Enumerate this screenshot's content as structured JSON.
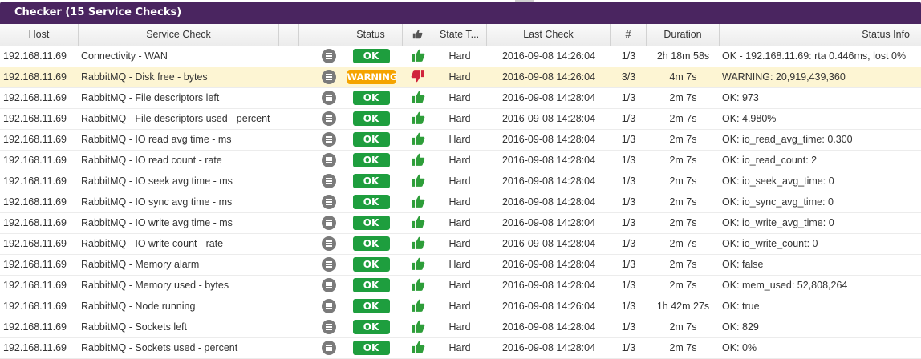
{
  "panel": {
    "title": "Checker (15 Service Checks)"
  },
  "columns": {
    "host": "Host",
    "service_check": "Service Check",
    "status": "Status",
    "ack_icon": "thumbs-up-icon",
    "state_type": "State T...",
    "last_check": "Last Check",
    "attempt": "#",
    "duration": "Duration",
    "status_info": "Status Info"
  },
  "colors": {
    "title_bar": "#4a2560",
    "ok": "#1e9e3e",
    "warning": "#f5a400",
    "thumb_up": "#2e9e3a",
    "thumb_down": "#d0233c",
    "warning_row": "#fdf5d3"
  },
  "rows": [
    {
      "host": "192.168.11.69",
      "service": "Connectivity - WAN",
      "status": "OK",
      "ack": "thumbs-up",
      "state_type": "Hard",
      "last_check": "2016-09-08 14:26:04",
      "attempt": "1/3",
      "duration": "2h 18m 58s",
      "info": "OK - 192.168.11.69: rta 0.446ms, lost 0%"
    },
    {
      "host": "192.168.11.69",
      "service": "RabbitMQ - Disk free - bytes",
      "status": "WARNING",
      "ack": "thumbs-down",
      "state_type": "Hard",
      "last_check": "2016-09-08 14:26:04",
      "attempt": "3/3",
      "duration": "4m 7s",
      "info": "WARNING: 20,919,439,360"
    },
    {
      "host": "192.168.11.69",
      "service": "RabbitMQ - File descriptors left",
      "status": "OK",
      "ack": "thumbs-up",
      "state_type": "Hard",
      "last_check": "2016-09-08 14:28:04",
      "attempt": "1/3",
      "duration": "2m 7s",
      "info": "OK: 973"
    },
    {
      "host": "192.168.11.69",
      "service": "RabbitMQ - File descriptors used - percent",
      "status": "OK",
      "ack": "thumbs-up",
      "state_type": "Hard",
      "last_check": "2016-09-08 14:28:04",
      "attempt": "1/3",
      "duration": "2m 7s",
      "info": "OK: 4.980%"
    },
    {
      "host": "192.168.11.69",
      "service": "RabbitMQ - IO read avg time - ms",
      "status": "OK",
      "ack": "thumbs-up",
      "state_type": "Hard",
      "last_check": "2016-09-08 14:28:04",
      "attempt": "1/3",
      "duration": "2m 7s",
      "info": "OK: io_read_avg_time: 0.300"
    },
    {
      "host": "192.168.11.69",
      "service": "RabbitMQ - IO read count - rate",
      "status": "OK",
      "ack": "thumbs-up",
      "state_type": "Hard",
      "last_check": "2016-09-08 14:28:04",
      "attempt": "1/3",
      "duration": "2m 7s",
      "info": "OK: io_read_count: 2"
    },
    {
      "host": "192.168.11.69",
      "service": "RabbitMQ - IO seek avg time - ms",
      "status": "OK",
      "ack": "thumbs-up",
      "state_type": "Hard",
      "last_check": "2016-09-08 14:28:04",
      "attempt": "1/3",
      "duration": "2m 7s",
      "info": "OK: io_seek_avg_time: 0"
    },
    {
      "host": "192.168.11.69",
      "service": "RabbitMQ - IO sync avg time - ms",
      "status": "OK",
      "ack": "thumbs-up",
      "state_type": "Hard",
      "last_check": "2016-09-08 14:28:04",
      "attempt": "1/3",
      "duration": "2m 7s",
      "info": "OK: io_sync_avg_time: 0"
    },
    {
      "host": "192.168.11.69",
      "service": "RabbitMQ - IO write avg time - ms",
      "status": "OK",
      "ack": "thumbs-up",
      "state_type": "Hard",
      "last_check": "2016-09-08 14:28:04",
      "attempt": "1/3",
      "duration": "2m 7s",
      "info": "OK: io_write_avg_time: 0"
    },
    {
      "host": "192.168.11.69",
      "service": "RabbitMQ - IO write count - rate",
      "status": "OK",
      "ack": "thumbs-up",
      "state_type": "Hard",
      "last_check": "2016-09-08 14:28:04",
      "attempt": "1/3",
      "duration": "2m 7s",
      "info": "OK: io_write_count: 0"
    },
    {
      "host": "192.168.11.69",
      "service": "RabbitMQ - Memory alarm",
      "status": "OK",
      "ack": "thumbs-up",
      "state_type": "Hard",
      "last_check": "2016-09-08 14:28:04",
      "attempt": "1/3",
      "duration": "2m 7s",
      "info": "OK: false"
    },
    {
      "host": "192.168.11.69",
      "service": "RabbitMQ - Memory used - bytes",
      "status": "OK",
      "ack": "thumbs-up",
      "state_type": "Hard",
      "last_check": "2016-09-08 14:28:04",
      "attempt": "1/3",
      "duration": "2m 7s",
      "info": "OK: mem_used: 52,808,264"
    },
    {
      "host": "192.168.11.69",
      "service": "RabbitMQ - Node running",
      "status": "OK",
      "ack": "thumbs-up",
      "state_type": "Hard",
      "last_check": "2016-09-08 14:26:04",
      "attempt": "1/3",
      "duration": "1h 42m 27s",
      "info": "OK: true"
    },
    {
      "host": "192.168.11.69",
      "service": "RabbitMQ - Sockets left",
      "status": "OK",
      "ack": "thumbs-up",
      "state_type": "Hard",
      "last_check": "2016-09-08 14:28:04",
      "attempt": "1/3",
      "duration": "2m 7s",
      "info": "OK: 829"
    },
    {
      "host": "192.168.11.69",
      "service": "RabbitMQ - Sockets used - percent",
      "status": "OK",
      "ack": "thumbs-up",
      "state_type": "Hard",
      "last_check": "2016-09-08 14:28:04",
      "attempt": "1/3",
      "duration": "2m 7s",
      "info": "OK: 0%"
    }
  ]
}
